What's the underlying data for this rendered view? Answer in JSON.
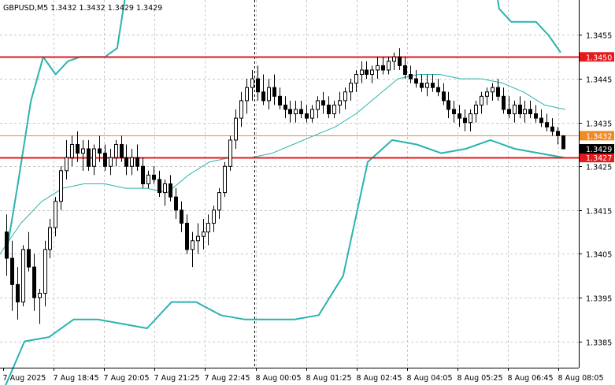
{
  "chart_data": {
    "type": "candlestick",
    "title": "GBPUSD,M5  1.3432 1.3432 1.3429 1.3429",
    "symbol": "GBPUSD",
    "timeframe": "M5",
    "ohlc_header": {
      "open": 1.3432,
      "high": 1.3432,
      "low": 1.3429,
      "close": 1.3429
    },
    "ylim": [
      1.3379,
      1.3463
    ],
    "y_ticks": [
      "1.3455",
      "1.3445",
      "1.3435",
      "1.3425",
      "1.3415",
      "1.3405",
      "1.3395",
      "1.3385"
    ],
    "x_ticks": [
      "7 Aug 2025",
      "7 Aug 18:45",
      "7 Aug 20:05",
      "7 Aug 21:25",
      "7 Aug 22:45",
      "8 Aug 00:05",
      "8 Aug 01:25",
      "8 Aug 02:45",
      "8 Aug 04:05",
      "8 Aug 05:25",
      "8 Aug 06:45",
      "8 Aug 08:05"
    ],
    "grid": true,
    "background": "#ffffff",
    "candle_color": "#000000",
    "horizontal_levels": [
      {
        "value": 1.345,
        "label": "1.3450",
        "color": "#e41a1c"
      },
      {
        "value": 1.3432,
        "label": "1.3432",
        "color": "#f08a24"
      },
      {
        "value": 1.3427,
        "label": "1.3427",
        "color": "#e41a1c"
      }
    ],
    "current_price": {
      "value": 1.3429,
      "label": "1.3429",
      "color": "#000000"
    },
    "session_separator": "8 Aug 00:05",
    "indicators": {
      "bollinger_color": "#2ab3ae",
      "ma_color": "#2ab3ae",
      "upper_band": [
        1.3405,
        1.3422,
        1.344,
        1.345,
        1.3446,
        1.3449,
        1.345,
        1.345,
        1.345,
        1.3452,
        1.347,
        1.348,
        1.348,
        1.348,
        1.348,
        1.348,
        1.348,
        1.348,
        1.348,
        1.348,
        1.348,
        1.348,
        1.348,
        1.348,
        1.348,
        1.348,
        1.348,
        1.348,
        1.348,
        1.348,
        1.348,
        1.348,
        1.348,
        1.348,
        1.348,
        1.348,
        1.348,
        1.348,
        1.348,
        1.348,
        1.3461,
        1.3458,
        1.3458,
        1.3458,
        1.3455,
        1.3451
      ],
      "middle_band": [
        1.3405,
        1.3412,
        1.3417,
        1.342,
        1.3421,
        1.3421,
        1.342,
        1.342,
        1.3419,
        1.3423,
        1.3426,
        1.3427,
        1.3427,
        1.3428,
        1.343,
        1.3432,
        1.3434,
        1.3437,
        1.3441,
        1.3445,
        1.3446,
        1.3446,
        1.3445,
        1.3445,
        1.3444,
        1.3442,
        1.3439,
        1.3438
      ],
      "lower_band": [
        1.3372,
        1.3385,
        1.3386,
        1.339,
        1.339,
        1.3389,
        1.3388,
        1.3394,
        1.3394,
        1.3391,
        1.339,
        1.339,
        1.339,
        1.3391,
        1.34,
        1.3426,
        1.3431,
        1.343,
        1.3428,
        1.3429,
        1.3431,
        1.3429,
        1.3428,
        1.3427
      ]
    },
    "candles": [
      [
        1.341,
        1.3414,
        1.34,
        1.3404
      ],
      [
        1.3404,
        1.3408,
        1.3392,
        1.3398
      ],
      [
        1.3398,
        1.3402,
        1.339,
        1.3394
      ],
      [
        1.3394,
        1.3407,
        1.3393,
        1.3406
      ],
      [
        1.3406,
        1.341,
        1.3401,
        1.3402
      ],
      [
        1.3402,
        1.3405,
        1.3392,
        1.3395
      ],
      [
        1.3395,
        1.3397,
        1.3389,
        1.3396
      ],
      [
        1.3396,
        1.3408,
        1.3393,
        1.3406
      ],
      [
        1.3406,
        1.3413,
        1.3404,
        1.3411
      ],
      [
        1.3411,
        1.3418,
        1.3409,
        1.3417
      ],
      [
        1.3417,
        1.3425,
        1.3415,
        1.3424
      ],
      [
        1.3424,
        1.3431,
        1.3422,
        1.3427
      ],
      [
        1.3427,
        1.3432,
        1.3425,
        1.343
      ],
      [
        1.343,
        1.3433,
        1.3426,
        1.3428
      ],
      [
        1.3428,
        1.3431,
        1.3424,
        1.3429
      ],
      [
        1.3429,
        1.3431,
        1.3424,
        1.3425
      ],
      [
        1.3425,
        1.343,
        1.3423,
        1.3429
      ],
      [
        1.3429,
        1.3432,
        1.3426,
        1.3428
      ],
      [
        1.3428,
        1.343,
        1.3424,
        1.3425
      ],
      [
        1.3425,
        1.3429,
        1.3423,
        1.3427
      ],
      [
        1.3427,
        1.3431,
        1.3425,
        1.343
      ],
      [
        1.343,
        1.3432,
        1.3426,
        1.3427
      ],
      [
        1.3427,
        1.343,
        1.3423,
        1.3425
      ],
      [
        1.3425,
        1.3429,
        1.3423,
        1.3427
      ],
      [
        1.3427,
        1.343,
        1.3424,
        1.3425
      ],
      [
        1.3425,
        1.3427,
        1.342,
        1.3421
      ],
      [
        1.3421,
        1.3424,
        1.342,
        1.3423
      ],
      [
        1.3423,
        1.3425,
        1.3421,
        1.3422
      ],
      [
        1.3422,
        1.3424,
        1.3418,
        1.3419
      ],
      [
        1.3419,
        1.3422,
        1.3416,
        1.3421
      ],
      [
        1.3421,
        1.3423,
        1.3417,
        1.3418
      ],
      [
        1.3418,
        1.342,
        1.3413,
        1.3415
      ],
      [
        1.3415,
        1.3417,
        1.341,
        1.3412
      ],
      [
        1.3412,
        1.3414,
        1.3405,
        1.3406
      ],
      [
        1.3406,
        1.341,
        1.3402,
        1.3408
      ],
      [
        1.3408,
        1.3412,
        1.3405,
        1.3409
      ],
      [
        1.3409,
        1.3413,
        1.3406,
        1.341
      ],
      [
        1.341,
        1.3414,
        1.3407,
        1.3412
      ],
      [
        1.3412,
        1.3416,
        1.341,
        1.3415
      ],
      [
        1.3415,
        1.342,
        1.3413,
        1.3419
      ],
      [
        1.3419,
        1.3426,
        1.3418,
        1.3425
      ],
      [
        1.3425,
        1.3432,
        1.3424,
        1.3431
      ],
      [
        1.3431,
        1.3438,
        1.3429,
        1.3436
      ],
      [
        1.3436,
        1.3442,
        1.3434,
        1.344
      ],
      [
        1.344,
        1.3445,
        1.3437,
        1.3443
      ],
      [
        1.3443,
        1.3447,
        1.344,
        1.3445
      ],
      [
        1.3445,
        1.3448,
        1.344,
        1.3442
      ],
      [
        1.3442,
        1.3446,
        1.3439,
        1.344
      ],
      [
        1.344,
        1.3445,
        1.3438,
        1.3443
      ],
      [
        1.3443,
        1.3446,
        1.3439,
        1.3441
      ],
      [
        1.3441,
        1.3443,
        1.3438,
        1.3439
      ],
      [
        1.3439,
        1.3441,
        1.3436,
        1.3438
      ],
      [
        1.3438,
        1.344,
        1.3435,
        1.3437
      ],
      [
        1.3437,
        1.344,
        1.3435,
        1.3438
      ],
      [
        1.3438,
        1.344,
        1.3436,
        1.3437
      ],
      [
        1.3437,
        1.3439,
        1.3435,
        1.3436
      ],
      [
        1.3436,
        1.3439,
        1.3435,
        1.3438
      ],
      [
        1.3438,
        1.3441,
        1.3436,
        1.344
      ],
      [
        1.344,
        1.3442,
        1.3437,
        1.3439
      ],
      [
        1.3439,
        1.3441,
        1.3436,
        1.3437
      ],
      [
        1.3437,
        1.344,
        1.3436,
        1.3439
      ],
      [
        1.3439,
        1.3442,
        1.3437,
        1.344
      ],
      [
        1.344,
        1.3443,
        1.3438,
        1.3442
      ],
      [
        1.3442,
        1.3445,
        1.344,
        1.3444
      ],
      [
        1.3444,
        1.3447,
        1.3442,
        1.3446
      ],
      [
        1.3446,
        1.3449,
        1.3444,
        1.3447
      ],
      [
        1.3447,
        1.3449,
        1.3445,
        1.3446
      ],
      [
        1.3446,
        1.3448,
        1.3444,
        1.3447
      ],
      [
        1.3447,
        1.345,
        1.3445,
        1.3448
      ],
      [
        1.3448,
        1.345,
        1.3446,
        1.3447
      ],
      [
        1.3447,
        1.345,
        1.3446,
        1.3449
      ],
      [
        1.3449,
        1.3451,
        1.3447,
        1.345
      ],
      [
        1.345,
        1.3452,
        1.3447,
        1.3448
      ],
      [
        1.3448,
        1.345,
        1.3445,
        1.3446
      ],
      [
        1.3446,
        1.3448,
        1.3444,
        1.3445
      ],
      [
        1.3445,
        1.3447,
        1.3443,
        1.3444
      ],
      [
        1.3444,
        1.3446,
        1.3442,
        1.3443
      ],
      [
        1.3443,
        1.3446,
        1.3441,
        1.3444
      ],
      [
        1.3444,
        1.3446,
        1.3442,
        1.3443
      ],
      [
        1.3443,
        1.3445,
        1.3441,
        1.3442
      ],
      [
        1.3442,
        1.3444,
        1.3439,
        1.344
      ],
      [
        1.344,
        1.3442,
        1.3436,
        1.3438
      ],
      [
        1.3438,
        1.344,
        1.3435,
        1.3437
      ],
      [
        1.3437,
        1.3439,
        1.3434,
        1.3436
      ],
      [
        1.3436,
        1.3438,
        1.3433,
        1.3435
      ],
      [
        1.3435,
        1.3438,
        1.3433,
        1.3437
      ],
      [
        1.3437,
        1.344,
        1.3435,
        1.3439
      ],
      [
        1.3439,
        1.3442,
        1.3437,
        1.3441
      ],
      [
        1.3441,
        1.3443,
        1.3439,
        1.3442
      ],
      [
        1.3442,
        1.3444,
        1.344,
        1.3443
      ],
      [
        1.3443,
        1.3445,
        1.344,
        1.3441
      ],
      [
        1.3441,
        1.3443,
        1.3437,
        1.3438
      ],
      [
        1.3438,
        1.3441,
        1.3436,
        1.3437
      ],
      [
        1.3437,
        1.344,
        1.3435,
        1.3439
      ],
      [
        1.3439,
        1.3441,
        1.3436,
        1.3437
      ],
      [
        1.3437,
        1.344,
        1.3435,
        1.3438
      ],
      [
        1.3438,
        1.344,
        1.3436,
        1.3437
      ],
      [
        1.3437,
        1.3439,
        1.3435,
        1.3436
      ],
      [
        1.3436,
        1.3438,
        1.3434,
        1.3435
      ],
      [
        1.3435,
        1.3437,
        1.3433,
        1.3434
      ],
      [
        1.3434,
        1.3436,
        1.3432,
        1.3433
      ],
      [
        1.3433,
        1.3434,
        1.343,
        1.3432
      ],
      [
        1.3432,
        1.3432,
        1.3429,
        1.3429
      ]
    ]
  }
}
